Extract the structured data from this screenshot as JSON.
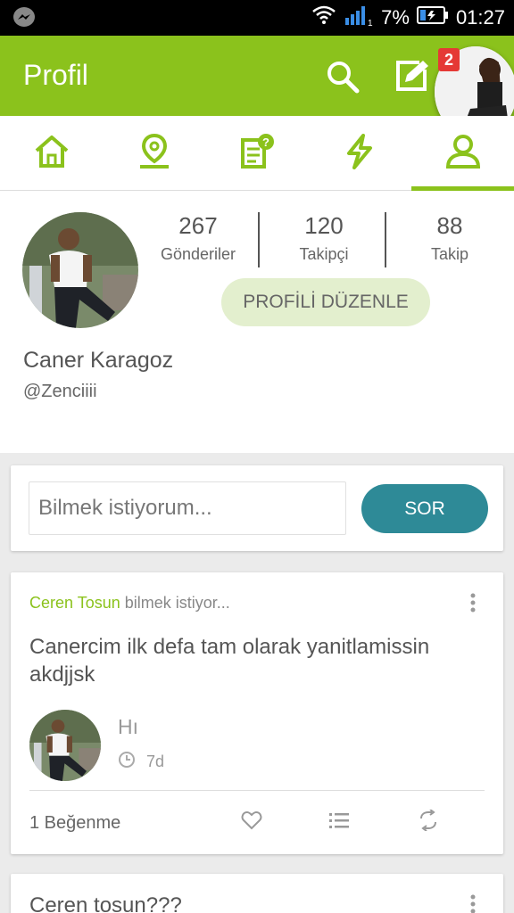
{
  "status_bar": {
    "battery_percent": "7%",
    "time": "01:27",
    "signal_sim": "1"
  },
  "app_bar": {
    "title": "Profil",
    "notification_count": "2"
  },
  "tabs": [
    {
      "icon": "home-icon",
      "active": false
    },
    {
      "icon": "location-icon",
      "active": false
    },
    {
      "icon": "question-note-icon",
      "active": false
    },
    {
      "icon": "lightning-icon",
      "active": false
    },
    {
      "icon": "user-icon",
      "active": true
    }
  ],
  "profile": {
    "stats": [
      {
        "value": "267",
        "label": "Gönderiler"
      },
      {
        "value": "120",
        "label": "Takipçi"
      },
      {
        "value": "88",
        "label": "Takip"
      }
    ],
    "edit_label": "PROFİLİ DÜZENLE",
    "name": "Caner Karagoz",
    "handle": "@Zenciiii"
  },
  "ask": {
    "placeholder": "Bilmek istiyorum...",
    "button_label": "SOR"
  },
  "post": {
    "author": "Ceren Tosun",
    "action": " bilmek istiyor...",
    "question": "Canercim ilk defa tam olarak yanitlamissin akdjjsk",
    "reply": "Hı",
    "reply_time": "7d",
    "likes": "1 Beğenme"
  },
  "next_post": {
    "question": "Ceren tosun???"
  },
  "colors": {
    "primary": "#8bc21c",
    "accent": "#2e8a97",
    "badge": "#e53935"
  }
}
